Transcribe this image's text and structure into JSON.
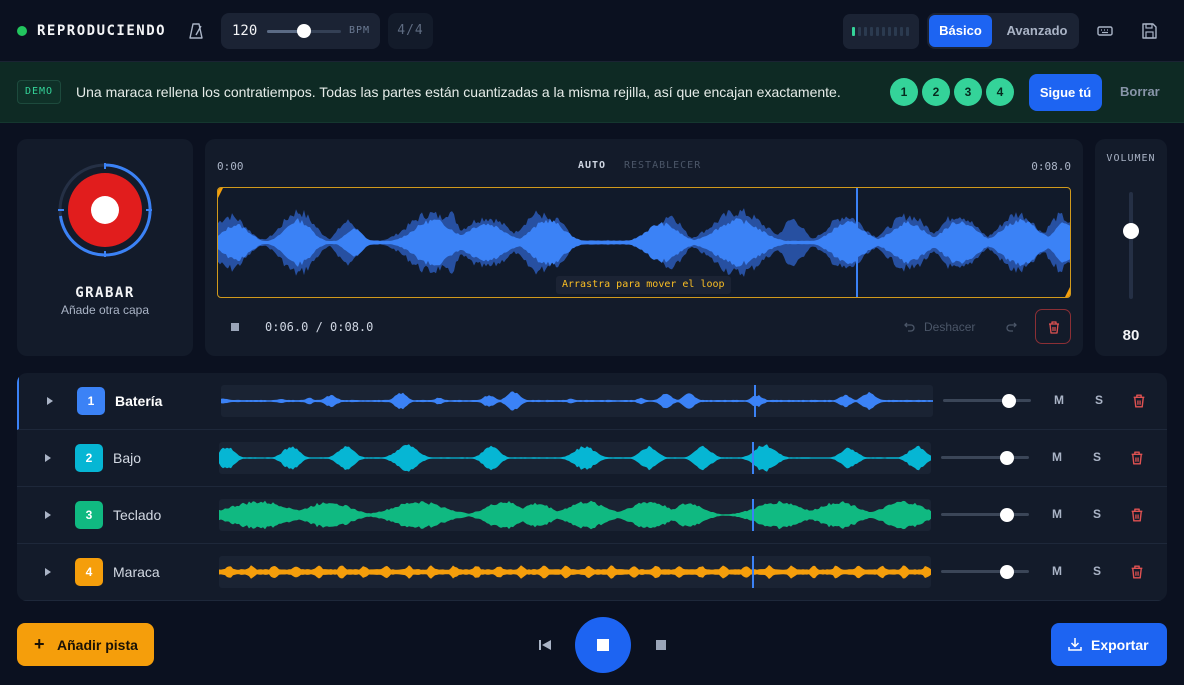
{
  "header": {
    "status": "REPRODUCIENDO",
    "tempo": {
      "value": "120",
      "unit": "BPM",
      "slider_fraction": 0.5
    },
    "time_signature": "4/4",
    "modes": {
      "active": "Básico",
      "inactive": "Avanzado"
    },
    "icons": [
      "metronome-icon",
      "level-meter",
      "keyboard-icon",
      "save-icon"
    ]
  },
  "banner": {
    "tag": "DEMO",
    "message": "Una maraca rellena los contratiempos. Todas las partes están cuantizadas a la misma rejilla, así que encajan exactamente.",
    "steps": [
      "1",
      "2",
      "3",
      "4"
    ],
    "follow_label": "Sigue tú",
    "clear_label": "Borrar"
  },
  "recorder": {
    "title": "GRABAR",
    "subtitle": "Añade otra capa"
  },
  "waveform": {
    "start_time": "0:00",
    "end_time": "0:08.0",
    "auto_label": "AUTO",
    "reset_label": "RESTABLECER",
    "loop_hint": "Arrastra para mover el loop",
    "position": "0:06.0 / 0:08.0",
    "undo_label": "Deshacer",
    "playhead_fraction": 0.75
  },
  "volume": {
    "label": "VOLUMEN",
    "value": "80",
    "fraction": 0.8
  },
  "tracks": [
    {
      "number": "1",
      "name": "Batería",
      "color": "#3b82f6",
      "selected": true,
      "volume_fraction": 0.75,
      "mute": "M",
      "solo": "S"
    },
    {
      "number": "2",
      "name": "Bajo",
      "color": "#06b6d4",
      "selected": false,
      "volume_fraction": 0.75,
      "mute": "M",
      "solo": "S"
    },
    {
      "number": "3",
      "name": "Teclado",
      "color": "#10b981",
      "selected": false,
      "volume_fraction": 0.75,
      "mute": "M",
      "solo": "S"
    },
    {
      "number": "4",
      "name": "Maraca",
      "color": "#f59e0b",
      "selected": false,
      "volume_fraction": 0.75,
      "mute": "M",
      "solo": "S"
    }
  ],
  "footer": {
    "add_track": "Añadir pista",
    "export": "Exportar"
  },
  "colors": {
    "accent": "#1d64f2",
    "success": "#34d399",
    "record": "#e11d1d",
    "warning": "#f59e0b"
  }
}
